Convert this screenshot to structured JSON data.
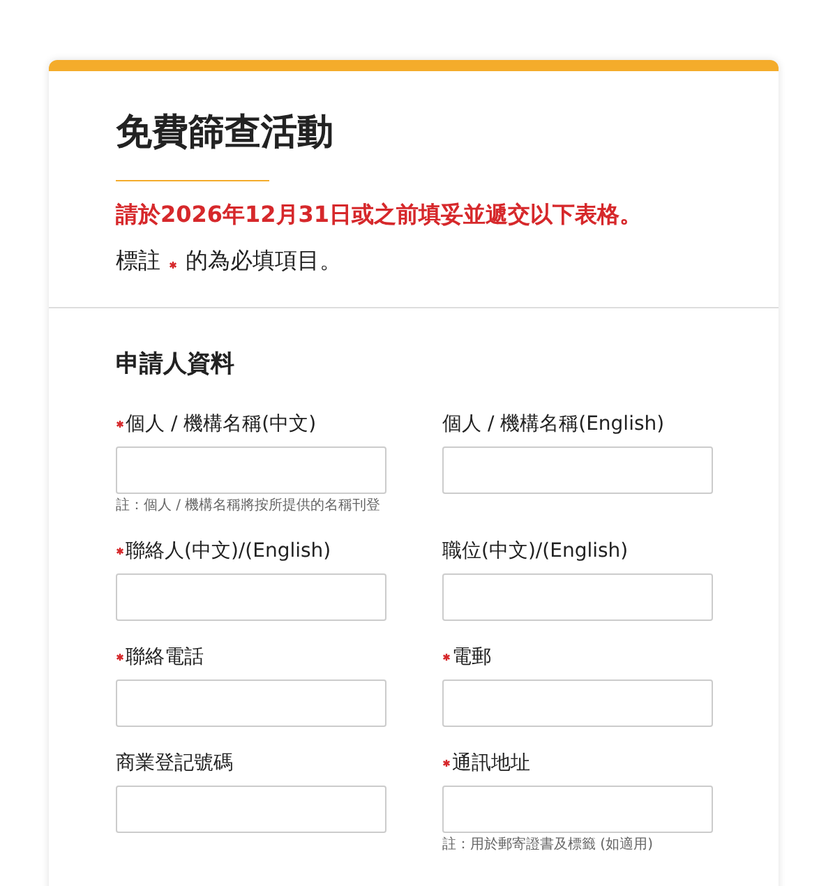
{
  "form": {
    "title": "免費篩查活動",
    "deadline": "請於2026年12月31日或之前填妥並遞交以下表格。",
    "legend": {
      "before": "標註",
      "after": "的為必填項目。"
    },
    "section": {
      "title": "申請人資料",
      "fields": [
        {
          "label": "個人 / 機構名稱(中文)",
          "required": true,
          "note": "註：個人 / 機構名稱將按所提供的名稱刊登"
        },
        {
          "label": "個人 / 機構名稱(English)",
          "required": false
        },
        {
          "label": "聯絡人(中文)/(English)",
          "required": true
        },
        {
          "label": "職位(中文)/(English)",
          "required": false
        },
        {
          "label": "聯絡電話",
          "required": true
        },
        {
          "label": "電郵",
          "required": true
        },
        {
          "label": "商業登記號碼",
          "required": false
        },
        {
          "label": "通訊地址",
          "required": true,
          "note": "註：用於郵寄證書及標籤 (如適用)"
        }
      ]
    }
  }
}
